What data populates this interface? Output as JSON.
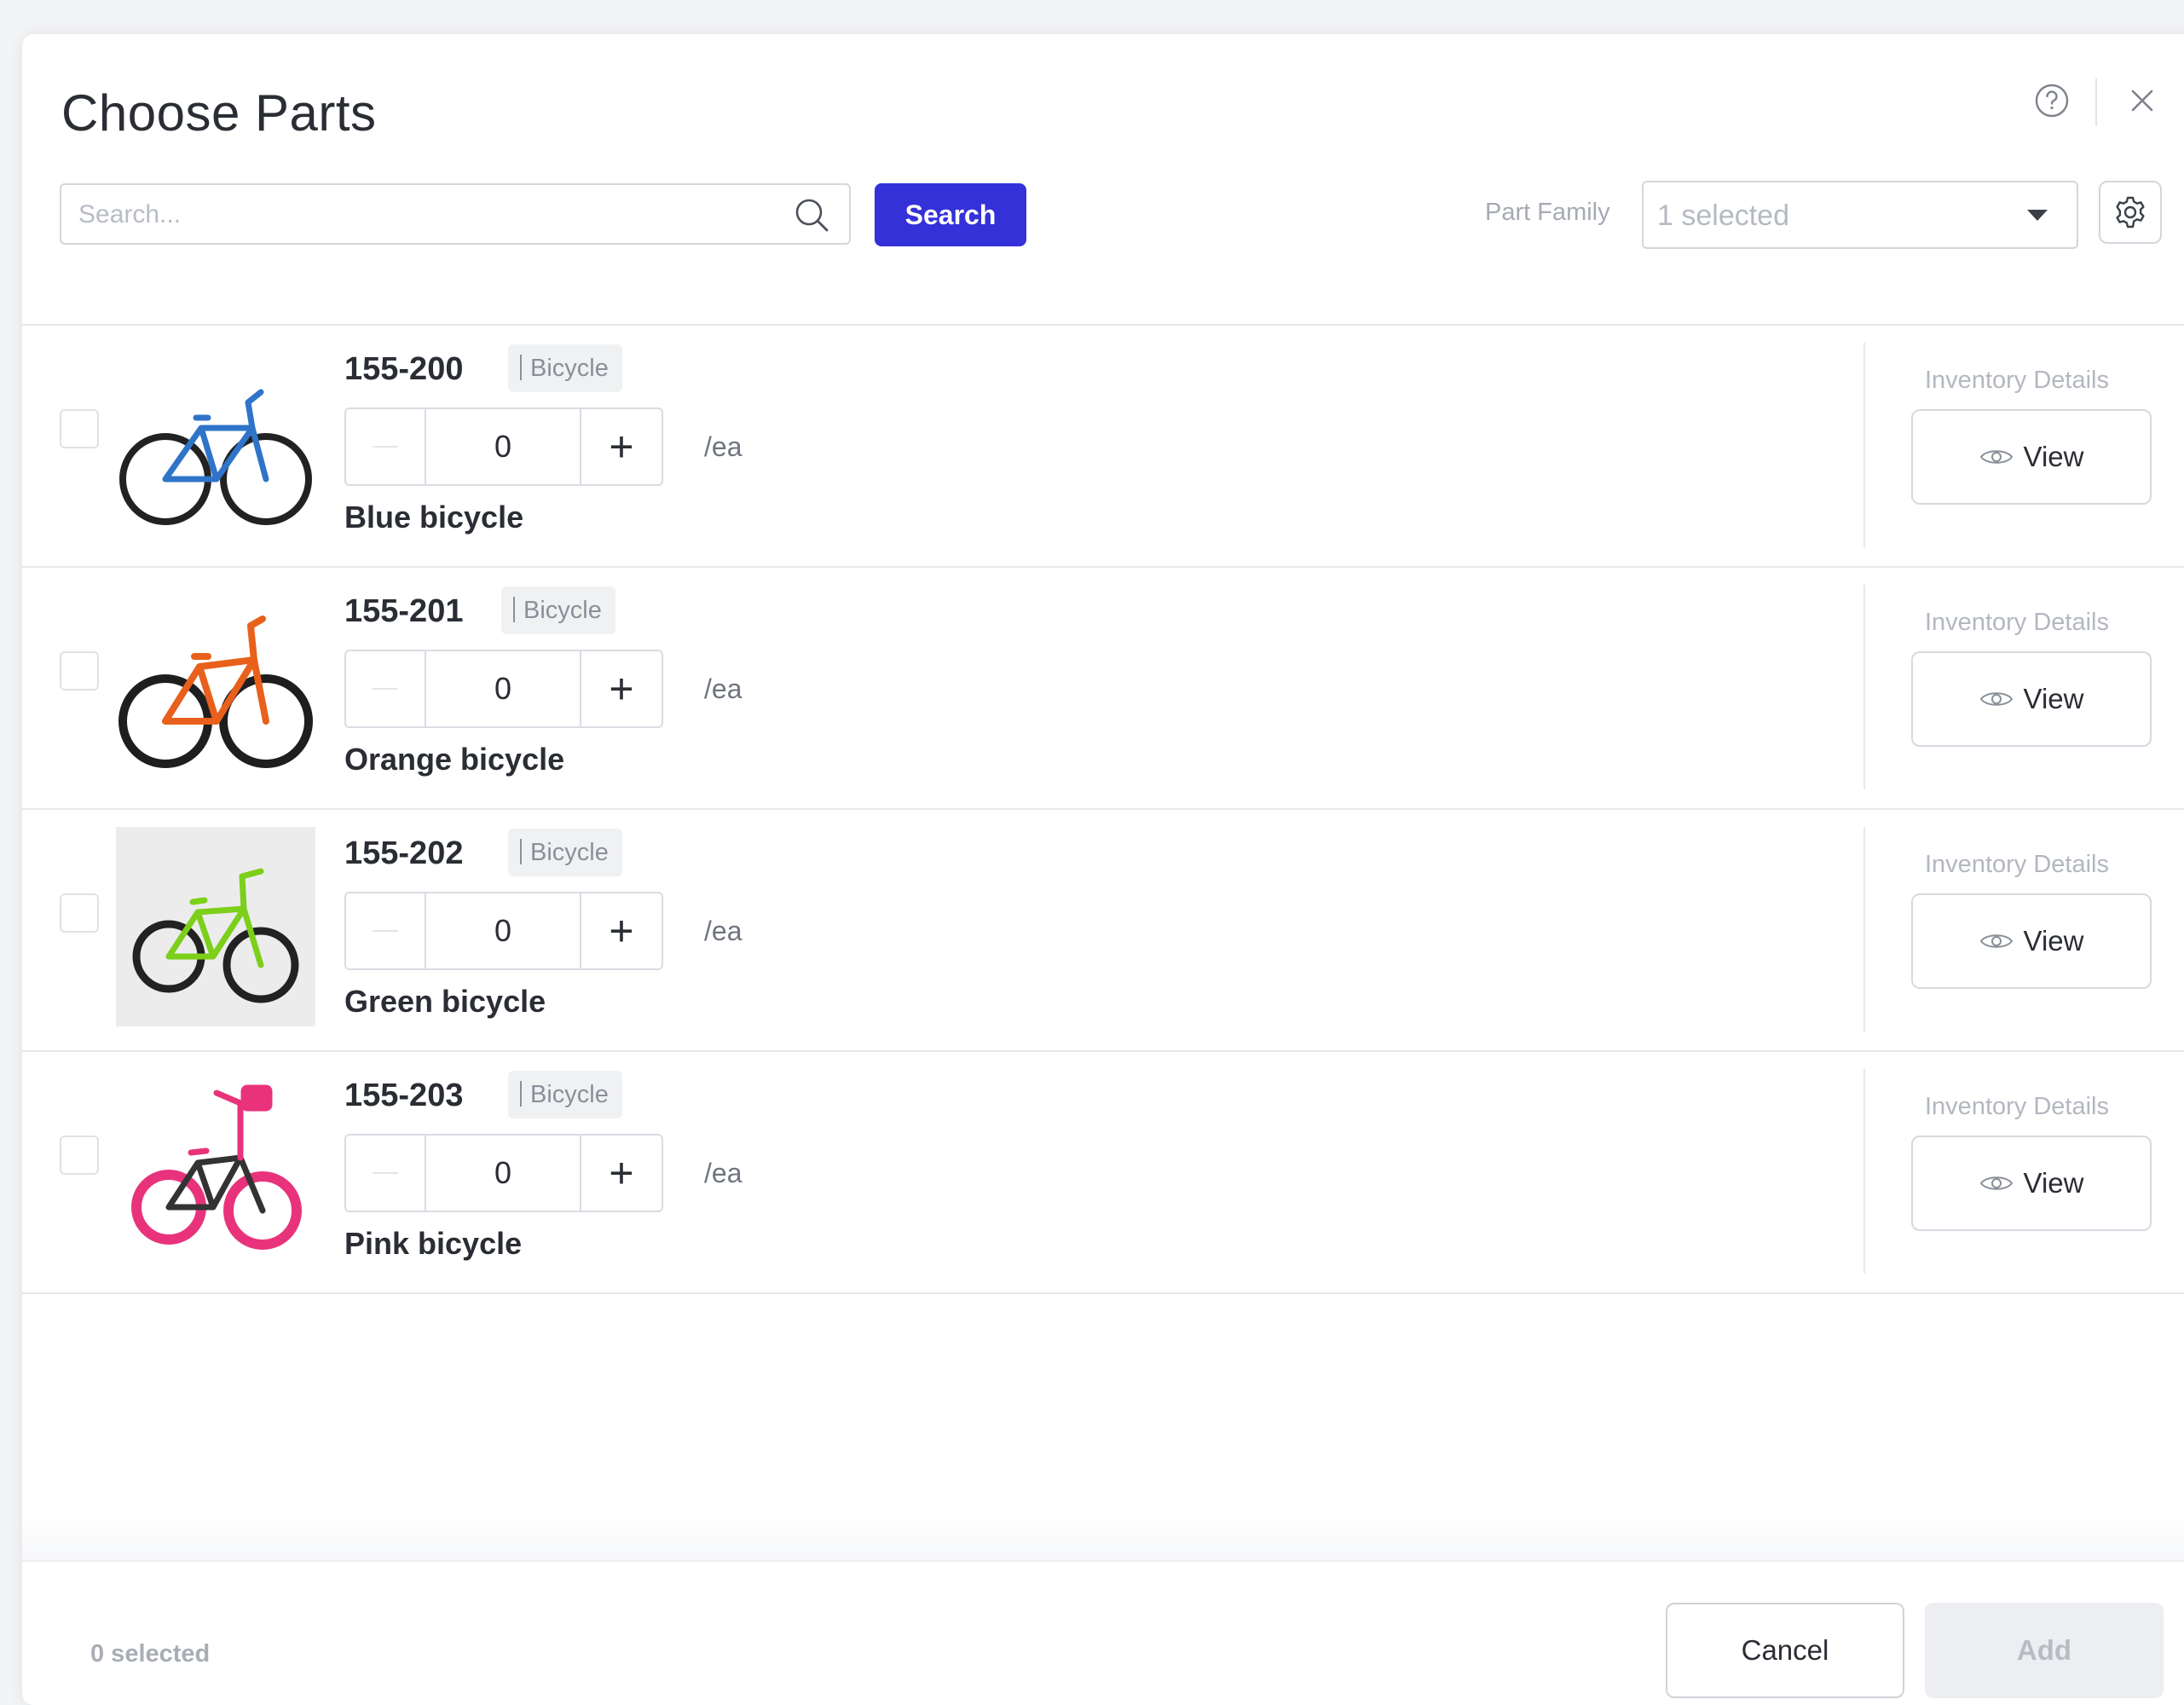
{
  "dialog": {
    "title": "Choose Parts",
    "help_icon": "help-circle-icon",
    "close_icon": "close-icon"
  },
  "search": {
    "placeholder": "Search...",
    "value": "",
    "button_label": "Search"
  },
  "filter": {
    "label": "Part Family",
    "selected_value": "1 selected",
    "settings_icon": "gear-icon"
  },
  "parts": [
    {
      "number": "155-200",
      "family": "Bicycle",
      "quantity": "0",
      "unit": "/ea",
      "name": "Blue bicycle",
      "color": "#2f74c9",
      "inventory_label": "Inventory Details",
      "view_label": "View"
    },
    {
      "number": "155-201",
      "family": "Bicycle",
      "quantity": "0",
      "unit": "/ea",
      "name": "Orange bicycle",
      "color": "#e8601c",
      "inventory_label": "Inventory Details",
      "view_label": "View"
    },
    {
      "number": "155-202",
      "family": "Bicycle",
      "quantity": "0",
      "unit": "/ea",
      "name": "Green bicycle",
      "color": "#7ccf1a",
      "inventory_label": "Inventory Details",
      "view_label": "View"
    },
    {
      "number": "155-203",
      "family": "Bicycle",
      "quantity": "0",
      "unit": "/ea",
      "name": "Pink bicycle",
      "color": "#e8337c",
      "inventory_label": "Inventory Details",
      "view_label": "View"
    }
  ],
  "footer": {
    "selected_count": "0 selected",
    "cancel_label": "Cancel",
    "add_label": "Add"
  },
  "colors": {
    "accent": "#3431d9"
  }
}
